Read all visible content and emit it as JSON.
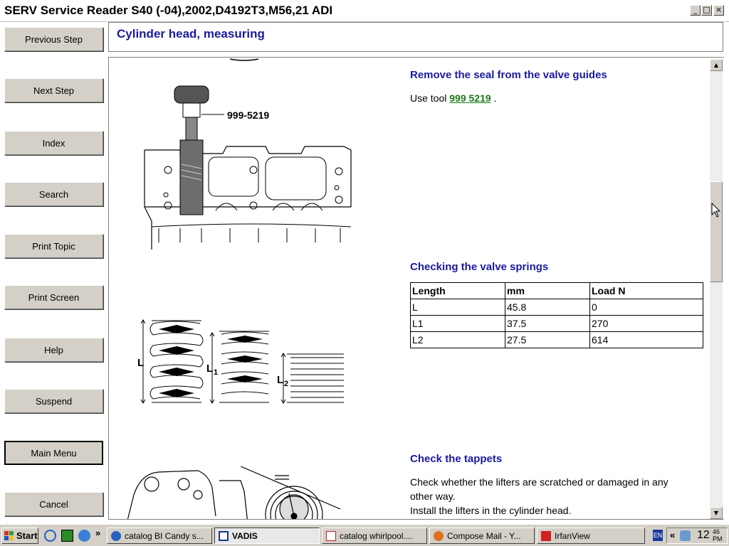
{
  "window": {
    "title": "SERV Service Reader S40 (-04),2002,D4192T3,M56,21 ADI",
    "controls": [
      "_",
      "□",
      "×"
    ]
  },
  "nav": {
    "buttons": [
      "Previous Step",
      "Next Step",
      "Index",
      "Search",
      "Print Topic",
      "Print Screen",
      "Help",
      "Suspend",
      "Main Menu",
      "Cancel"
    ]
  },
  "header": {
    "title": "Cylinder head, measuring"
  },
  "content": {
    "section1": {
      "title": "Remove the seal from the valve guides",
      "text_prefix": "Use tool ",
      "tool": "999 5219",
      "text_suffix": " .",
      "fig_label": "999-5219"
    },
    "section2": {
      "title": "Checking the valve springs",
      "table": {
        "headers": [
          "Length",
          "mm",
          "Load N"
        ],
        "rows": [
          [
            "L",
            "45.8",
            "0"
          ],
          [
            "L1",
            "37.5",
            "270"
          ],
          [
            "L2",
            "27.5",
            "614"
          ]
        ]
      },
      "fig_labels": {
        "l": "L",
        "l1": "L",
        "l1_sub": "1",
        "l2": "L",
        "l2_sub": "2"
      }
    },
    "section3": {
      "title": "Check the tappets",
      "line1": "Check whether the lifters are scratched or damaged in any",
      "line2": "other way.",
      "line3": "Install the lifters in the cylinder head."
    }
  },
  "taskbar": {
    "start_label": "Start",
    "chevron": "»",
    "tasks": [
      "catalog BI Candy s...",
      "VADIS",
      "catalog whirlpool....",
      "Compose Mail - Y...",
      "IrfanView"
    ],
    "active_task": "VADIS",
    "tray": {
      "lang": "EN",
      "chevron": "«",
      "time_hour": "12",
      "time_min": "46",
      "ampm": "PM"
    }
  },
  "colors": {
    "heading": "#1a1aa0",
    "tool_link": "#1a7a1a",
    "button_face": "#d4d0c8"
  }
}
